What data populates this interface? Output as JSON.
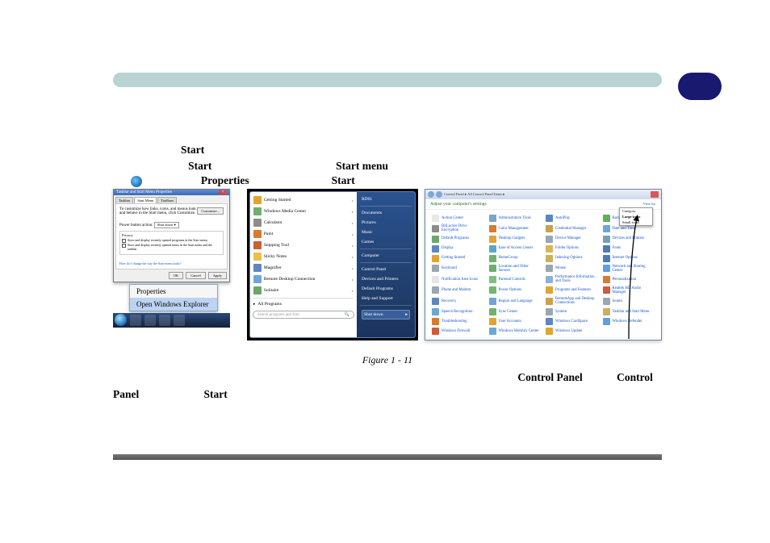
{
  "body": {
    "word_start1": "Start",
    "word_start2": "Start",
    "word_start3": "Start menu",
    "word_props": "Properties",
    "word_start4": "Start",
    "word_cp1": "Control Panel",
    "word_cp2": "Control",
    "word_panel": "Panel",
    "word_start5": "Start"
  },
  "figure_caption": "Figure 1 - 11",
  "shot1": {
    "dialog": {
      "title": "Taskbar and Start Menu Properties",
      "tabs": [
        "Taskbar",
        "Start Menu",
        "Toolbars"
      ],
      "desc": "To customize how links, icons, and menus look and behave in the Start menu, click Customize.",
      "customize_btn": "Customize...",
      "power_label": "Power button action:",
      "power_value": "Shut down",
      "privacy_title": "Privacy",
      "chk1": "Store and display recently opened programs in the Start menu",
      "chk2": "Store and display recently opened items in the Start menu and the taskbar",
      "link": "How do I change the way the Start menu looks?",
      "ok": "OK",
      "cancel": "Cancel",
      "apply": "Apply"
    },
    "context_menu": {
      "item1": "Properties",
      "item2": "Open Windows Explorer"
    }
  },
  "shot2": {
    "left_items": [
      "Getting Started",
      "Windows Media Center",
      "Calculator",
      "Paint",
      "Snipping Tool",
      "Sticky Notes",
      "Magnifier",
      "Remote Desktop Connection",
      "Solitaire"
    ],
    "all_programs": "All Programs",
    "search_placeholder": "Search programs and files",
    "right_items": [
      "RD01",
      "Documents",
      "Pictures",
      "Music",
      "Games",
      "Computer",
      "Control Panel",
      "Devices and Printers",
      "Default Programs",
      "Help and Support"
    ],
    "shutdown": "Shut down"
  },
  "shot3": {
    "breadcrumb": "Control Panel  ▸  All Control Panel Items  ▸",
    "adjust": "Adjust your computer's settings",
    "view_label": "View by:",
    "dropdown": {
      "opt1": "Category",
      "opt2": "Large icons",
      "opt3": "Small icons"
    },
    "items": [
      "Action Center",
      "Administrative Tools",
      "AutoPlay",
      "Backup and Restore",
      "BitLocker Drive Encryption",
      "Color Management",
      "Credential Manager",
      "Date and Time",
      "Default Programs",
      "Desktop Gadgets",
      "Device Manager",
      "Devices and Printers",
      "Display",
      "Ease of Access Center",
      "Folder Options",
      "Fonts",
      "Getting Started",
      "HomeGroup",
      "Indexing Options",
      "Internet Options",
      "Keyboard",
      "Location and Other Sensors",
      "Mouse",
      "Network and Sharing Center",
      "Notification Area Icons",
      "Parental Controls",
      "Performance Information and Tools",
      "Personalization",
      "Phone and Modem",
      "Power Options",
      "Programs and Features",
      "Realtek HD Audio Manager",
      "Recovery",
      "Region and Language",
      "RemoteApp and Desktop Connections",
      "Sound",
      "Speech Recognition",
      "Sync Center",
      "System",
      "Taskbar and Start Menu",
      "Troubleshooting",
      "User Accounts",
      "Windows CardSpace",
      "Windows Defender",
      "Windows Firewall",
      "Windows Mobility Center",
      "Windows Update",
      ""
    ],
    "icon_colors": [
      "#e8e8e8",
      "#7aa6c8",
      "#5b86c4",
      "#5fae5b",
      "#8c8c8c",
      "#d77b2e",
      "#c8a24c",
      "#6ea6d8",
      "#6da66d",
      "#e0a530",
      "#9aa7b2",
      "#6fa3b6",
      "#5f86c2",
      "#58a9c6",
      "#d8b45a",
      "#4c7bb7",
      "#e0a530",
      "#6fb26f",
      "#c9b25a",
      "#4c7bb7",
      "#9aa7b2",
      "#6fae6f",
      "#9aa7b2",
      "#5f9fde",
      "#e6e6e6",
      "#7fbf7f",
      "#8db0d8",
      "#d77b2e",
      "#9aa7b2",
      "#6db86d",
      "#e0a530",
      "#d05a3a",
      "#5f86c2",
      "#6ea6d8",
      "#c8a24c",
      "#9aa7b2",
      "#6ea6d8",
      "#6fb26f",
      "#9aa7b2",
      "#c9b25a",
      "#d77b2e",
      "#e0a530",
      "#5f86c2",
      "#5f9fde",
      "#d05a3a",
      "#6ea6d8",
      "#e0a530",
      ""
    ]
  }
}
